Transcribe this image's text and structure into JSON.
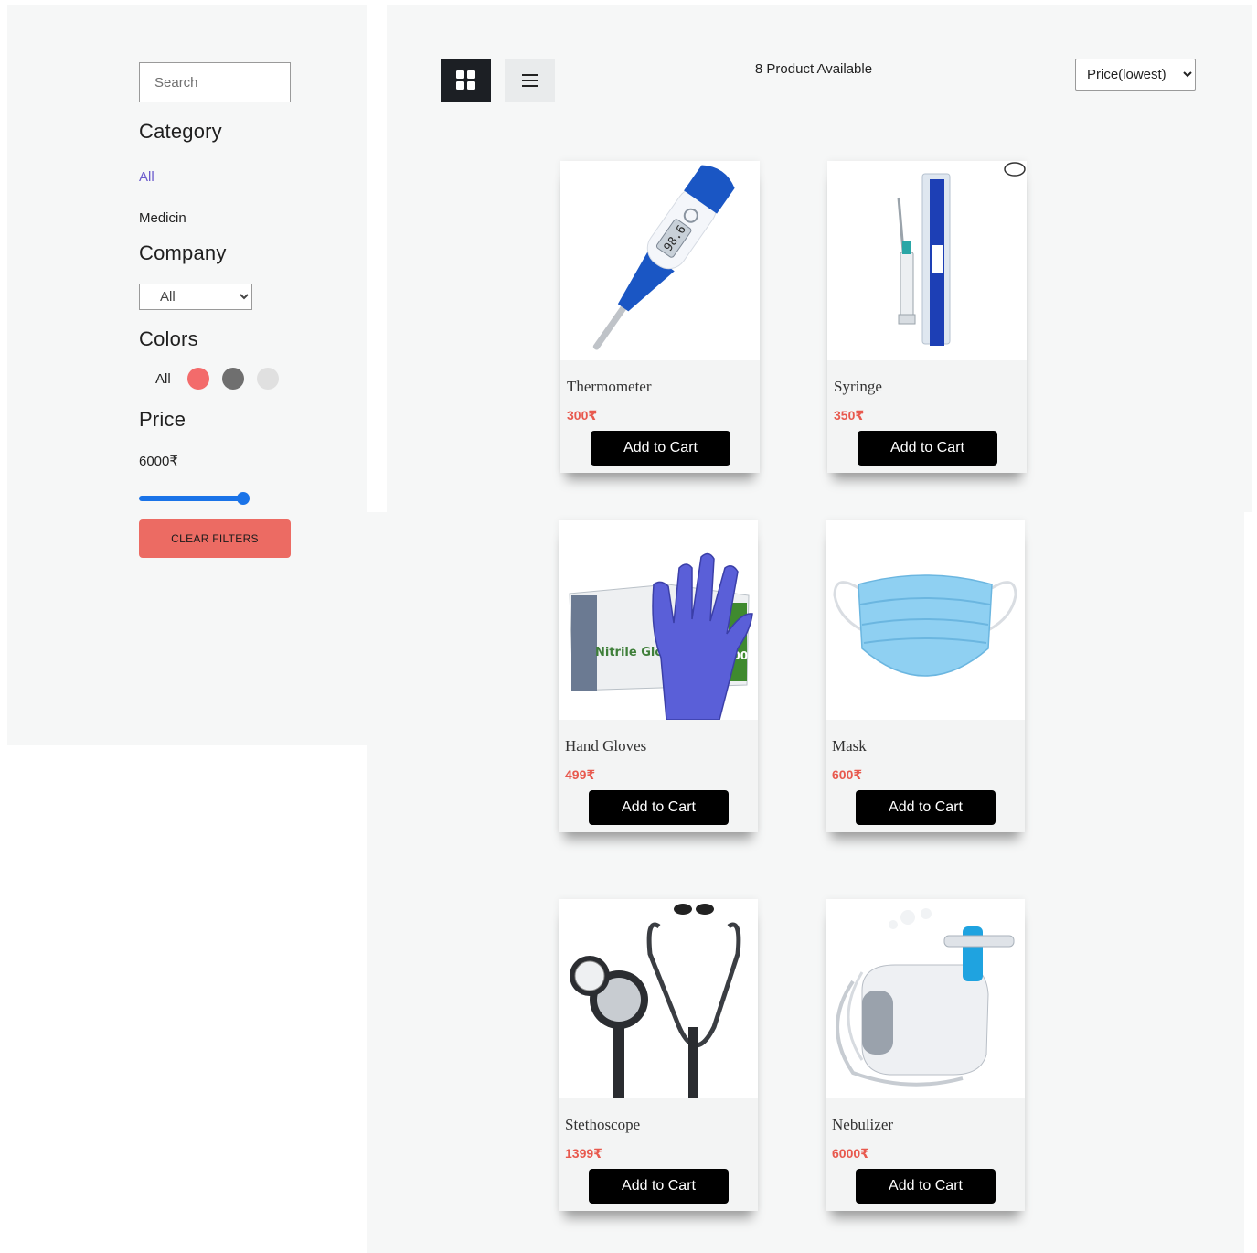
{
  "sidebar": {
    "search_placeholder": "Search",
    "category_heading": "Category",
    "categories": [
      "All",
      "Medicin"
    ],
    "company_heading": "Company",
    "company_selected": "All",
    "colors_heading": "Colors",
    "colors_all_label": "All",
    "colors": [
      "#f36b6b",
      "#6f6f6f",
      "#e0e0e0"
    ],
    "price_heading": "Price",
    "price_value": "6000₹",
    "price_slider_fraction": 1.0,
    "clear_filters_label": "CLEAR FILTERS"
  },
  "toolbar": {
    "grid_view_icon": "grid-view-icon",
    "list_view_icon": "list-view-icon",
    "product_count": "8 Product Available",
    "sort_selected": "Price(lowest)"
  },
  "products": [
    {
      "name": "Thermometer",
      "price": "300₹",
      "button": "Add to Cart",
      "icon": "thermometer-image"
    },
    {
      "name": "Syringe",
      "price": "350₹",
      "button": "Add to Cart",
      "icon": "syringe-image"
    },
    {
      "name": "Hand Gloves",
      "price": "499₹",
      "button": "Add to Cart",
      "icon": "gloves-image"
    },
    {
      "name": "Mask",
      "price": "600₹",
      "button": "Add to Cart",
      "icon": "mask-image"
    },
    {
      "name": "Stethoscope",
      "price": "1399₹",
      "button": "Add to Cart",
      "icon": "stethoscope-image"
    },
    {
      "name": "Nebulizer",
      "price": "6000₹",
      "button": "Add to Cart",
      "icon": "nebulizer-image"
    }
  ],
  "image_text": {
    "thermometer_reading": "98.6",
    "gloves_box_label": "Nitrile Glove",
    "gloves_count": "100"
  }
}
